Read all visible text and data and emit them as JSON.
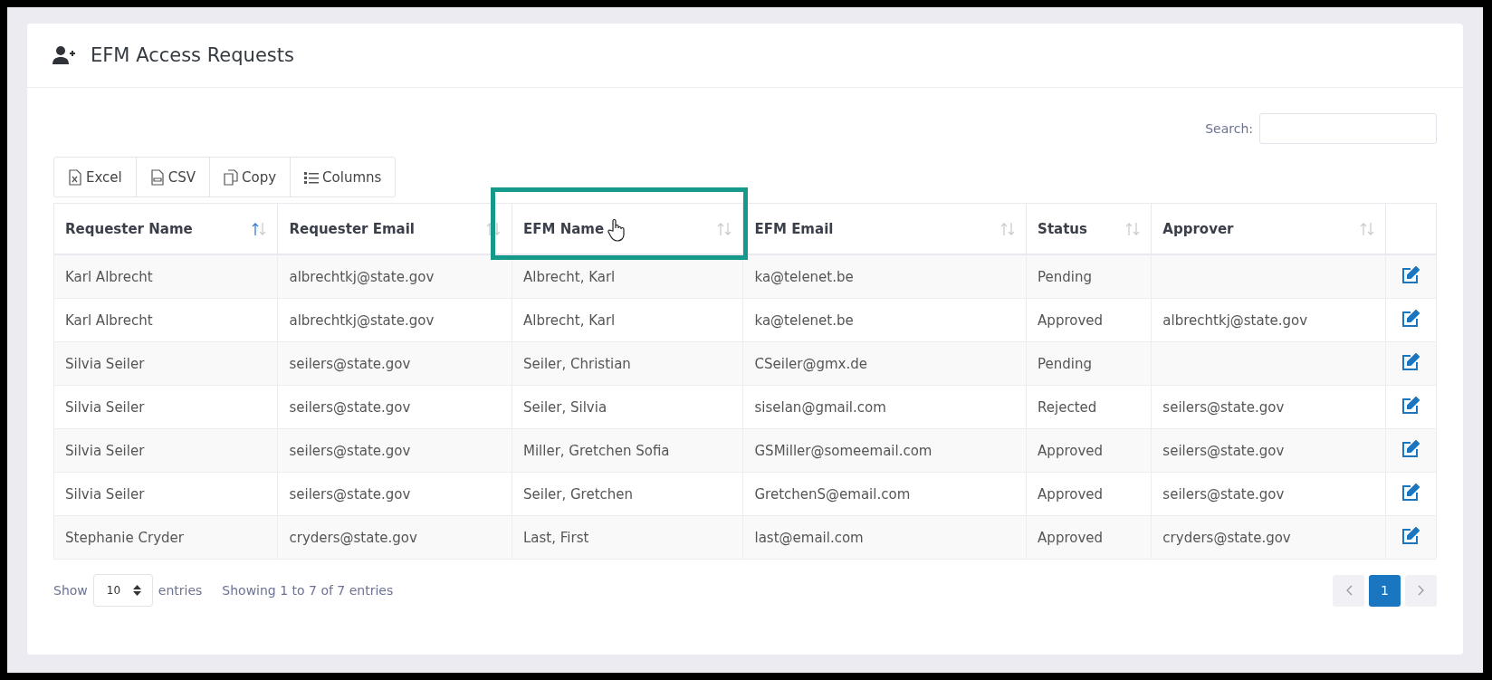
{
  "page": {
    "title": "EFM Access Requests"
  },
  "search": {
    "label": "Search:"
  },
  "toolbar": [
    {
      "kind": "excel",
      "label": "Excel"
    },
    {
      "kind": "csv",
      "label": "CSV"
    },
    {
      "kind": "copy",
      "label": "Copy"
    },
    {
      "kind": "columns",
      "label": "Columns"
    }
  ],
  "table": {
    "columns": [
      {
        "label": "Requester Name",
        "sorted_ascending": true,
        "highlighted": false
      },
      {
        "label": "Requester Email",
        "sorted_ascending": false,
        "highlighted": false
      },
      {
        "label": "EFM Name",
        "sorted_ascending": false,
        "highlighted": true
      },
      {
        "label": "EFM Email",
        "sorted_ascending": false,
        "highlighted": false
      },
      {
        "label": "Status",
        "sorted_ascending": false,
        "highlighted": false
      },
      {
        "label": "Approver",
        "sorted_ascending": false,
        "highlighted": false
      }
    ],
    "rows": [
      [
        "Karl Albrecht",
        "albrechtkj@state.gov",
        "Albrecht, Karl",
        "ka@telenet.be",
        "Pending",
        ""
      ],
      [
        "Karl Albrecht",
        "albrechtkj@state.gov",
        "Albrecht, Karl",
        "ka@telenet.be",
        "Approved",
        "albrechtkj@state.gov"
      ],
      [
        "Silvia Seiler",
        "seilers@state.gov",
        "Seiler, Christian",
        "CSeiler@gmx.de",
        "Pending",
        ""
      ],
      [
        "Silvia Seiler",
        "seilers@state.gov",
        "Seiler, Silvia",
        "siselan@gmail.com",
        "Rejected",
        "seilers@state.gov"
      ],
      [
        "Silvia Seiler",
        "seilers@state.gov",
        "Miller, Gretchen Sofia",
        "GSMiller@someemail.com",
        "Approved",
        "seilers@state.gov"
      ],
      [
        "Silvia Seiler",
        "seilers@state.gov",
        "Seiler, Gretchen",
        "GretchenS@email.com",
        "Approved",
        "seilers@state.gov"
      ],
      [
        "Stephanie Cryder",
        "cryders@state.gov",
        "Last, First",
        "last@email.com",
        "Approved",
        "cryders@state.gov"
      ]
    ]
  },
  "footer": {
    "show": "Show",
    "page_size": "10",
    "entries": "entries",
    "info": "Showing 1 to 7 of 7 entries"
  },
  "pagination": [
    {
      "label": "1",
      "selected": true
    }
  ]
}
